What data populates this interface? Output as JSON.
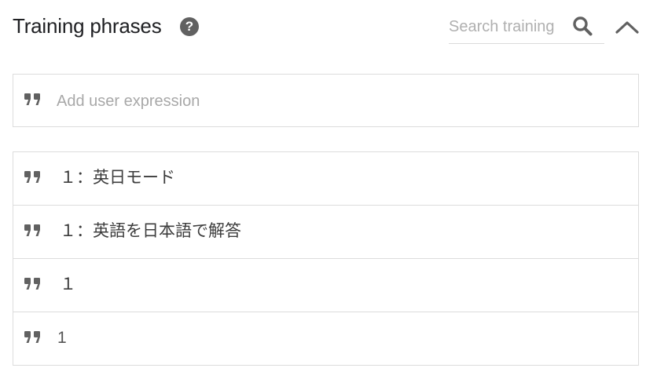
{
  "header": {
    "title": "Training phrases",
    "help_icon": "help-circle-icon",
    "help_glyph": "?"
  },
  "search": {
    "placeholder": "Search training",
    "icon": "search-icon"
  },
  "collapse": {
    "icon": "chevron-up-icon"
  },
  "add_expression": {
    "placeholder": "Add user expression",
    "icon": "quote-icon"
  },
  "phrases": [
    {
      "text": "１：英日モード"
    },
    {
      "text": "１：英語を日本語で解答"
    },
    {
      "text": "１"
    },
    {
      "text": "1"
    }
  ],
  "colors": {
    "icon_gray": "#616161",
    "border": "#dcdcdc",
    "text": "#202124"
  }
}
